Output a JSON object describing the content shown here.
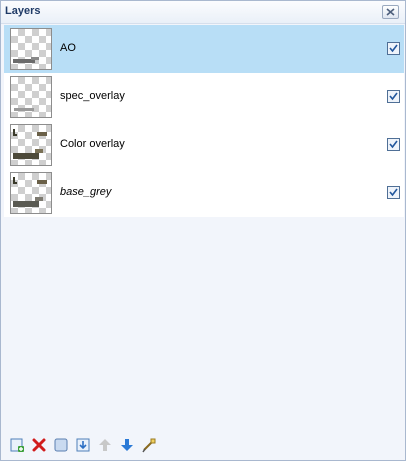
{
  "window": {
    "title": "Layers"
  },
  "layers": [
    {
      "name": "AO",
      "selected": true,
      "visible": true,
      "italic": false
    },
    {
      "name": "spec_overlay",
      "selected": false,
      "visible": true,
      "italic": false
    },
    {
      "name": "Color overlay",
      "selected": false,
      "visible": true,
      "italic": false
    },
    {
      "name": "base_grey",
      "selected": false,
      "visible": true,
      "italic": true
    }
  ],
  "toolbar": {
    "buttons": [
      {
        "icon": "add-layer-icon"
      },
      {
        "icon": "delete-layer-icon"
      },
      {
        "icon": "duplicate-layer-icon"
      },
      {
        "icon": "merge-down-icon"
      },
      {
        "icon": "move-up-icon"
      },
      {
        "icon": "move-down-icon"
      },
      {
        "icon": "layer-properties-icon"
      }
    ]
  },
  "colors": {
    "selected_row": "#b8def6",
    "panel_bg": "#f2f5fb",
    "border": "#a9b8cf"
  }
}
